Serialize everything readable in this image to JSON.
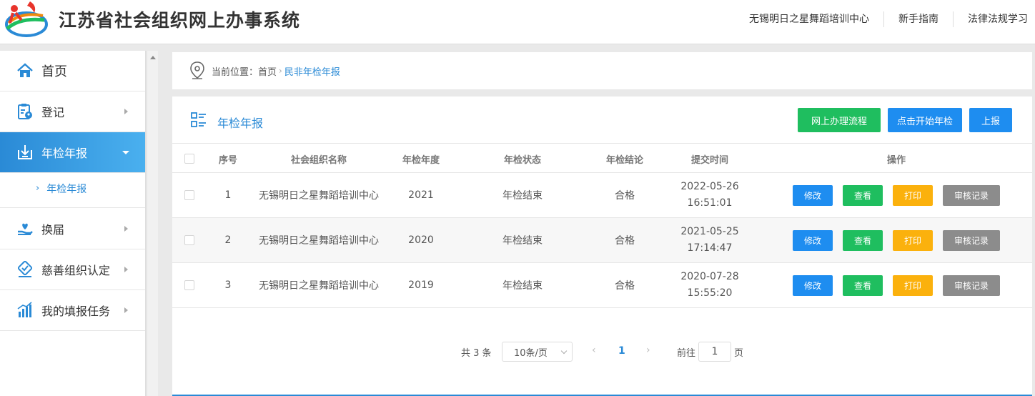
{
  "header": {
    "title": "江苏省社会组织网上办事系统",
    "links": [
      "无锡明日之星舞蹈培训中心",
      "新手指南",
      "法律法规学习"
    ]
  },
  "sidebar": {
    "items": [
      {
        "label": "首页",
        "icon": "home-icon"
      },
      {
        "label": "登记",
        "icon": "clipboard-icon"
      },
      {
        "label": "年检年报",
        "icon": "download-tray-icon"
      },
      {
        "label": "换届",
        "icon": "hand-heart-icon"
      },
      {
        "label": "慈善组织认定",
        "icon": "badge-check-icon"
      },
      {
        "label": "我的填报任务",
        "icon": "bar-chart-icon"
      }
    ],
    "sub_item": "年检年报"
  },
  "breadcrumb": {
    "prefix": "当前位置：首页",
    "current": "民非年检年报"
  },
  "panel": {
    "title": "年检年报",
    "buttons": {
      "process": "网上办理流程",
      "start": "点击开始年检",
      "submit": "上报"
    }
  },
  "table": {
    "columns": [
      "序号",
      "社会组织名称",
      "年检年度",
      "年检状态",
      "年检结论",
      "提交时间",
      "操作"
    ],
    "rows": [
      {
        "no": "1",
        "name": "无锡明日之星舞蹈培训中心",
        "year": "2021",
        "status": "年检结束",
        "result": "合格",
        "time": "2022-05-26 16:51:01"
      },
      {
        "no": "2",
        "name": "无锡明日之星舞蹈培训中心",
        "year": "2020",
        "status": "年检结束",
        "result": "合格",
        "time": "2021-05-25 17:14:47"
      },
      {
        "no": "3",
        "name": "无锡明日之星舞蹈培训中心",
        "year": "2019",
        "status": "年检结束",
        "result": "合格",
        "time": "2020-07-28 15:55:20"
      }
    ],
    "actions": {
      "edit": "修改",
      "view": "查看",
      "print": "打印",
      "audit": "审核记录"
    }
  },
  "pagination": {
    "total": "共 3 条",
    "page_size": "10条/页",
    "current_page": "1",
    "goto_label": "前往",
    "goto_value": "1",
    "page_unit": "页"
  },
  "colors": {
    "accent": "#2a8ad6",
    "green": "#1fbe5f",
    "blue": "#1e8df0",
    "orange": "#fbb10d",
    "gray": "#8c8c8c"
  }
}
